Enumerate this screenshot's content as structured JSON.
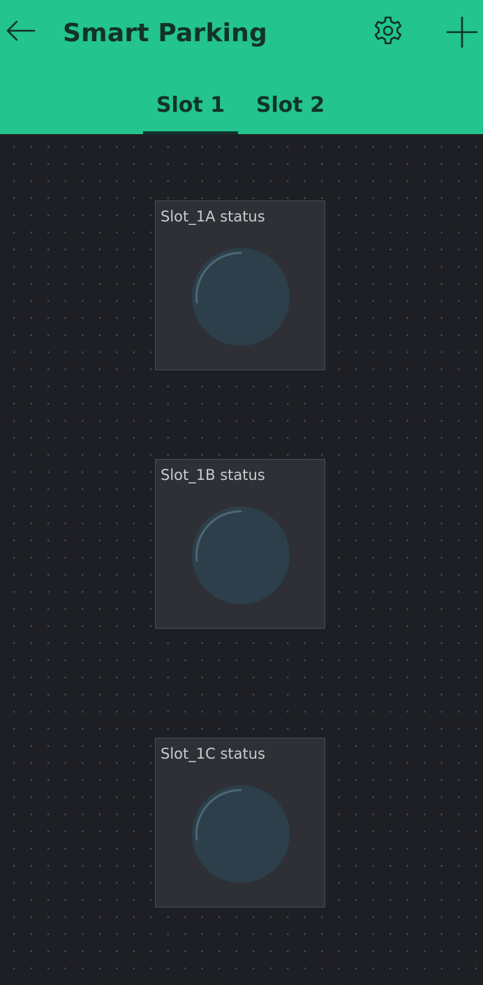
{
  "app": {
    "title": "Smart Parking"
  },
  "header": {
    "back_icon": "arrow-left-icon",
    "settings_icon": "gear-icon",
    "add_icon": "plus-icon",
    "background_color": "#23c48e",
    "text_color": "#12322a"
  },
  "tabs": [
    {
      "label": "Slot 1",
      "active": true
    },
    {
      "label": "Slot 2",
      "active": false
    }
  ],
  "widgets": [
    {
      "label": "Slot_1A status",
      "type": "led",
      "state": "off",
      "led_color": "#2c3f4b"
    },
    {
      "label": "Slot_1B status",
      "type": "led",
      "state": "off",
      "led_color": "#2c3f4b"
    },
    {
      "label": "Slot_1C status",
      "type": "led",
      "state": "off",
      "led_color": "#2c3f4b"
    }
  ],
  "canvas": {
    "background_color": "#1e1f24"
  }
}
